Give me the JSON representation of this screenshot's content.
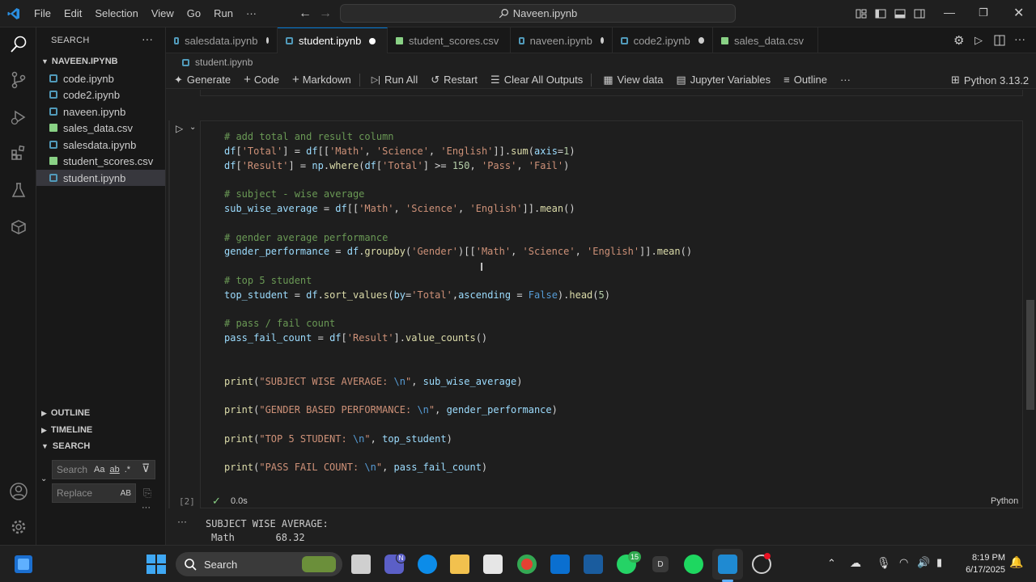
{
  "titlebar": {
    "menu": [
      "File",
      "Edit",
      "Selection",
      "View",
      "Go",
      "Run",
      "···"
    ],
    "search": "Naveen.ipynb"
  },
  "sidebar": {
    "title": "SEARCH",
    "folder": "NAVEEN.IPYNB",
    "files": [
      {
        "name": "code.ipynb",
        "type": "nb"
      },
      {
        "name": "code2.ipynb",
        "type": "nb"
      },
      {
        "name": "naveen.ipynb",
        "type": "nb"
      },
      {
        "name": "sales_data.csv",
        "type": "csv"
      },
      {
        "name": "salesdata.ipynb",
        "type": "nb"
      },
      {
        "name": "student_scores.csv",
        "type": "csv"
      },
      {
        "name": "student.ipynb",
        "type": "nb"
      }
    ],
    "sections": [
      "OUTLINE",
      "TIMELINE",
      "SEARCH"
    ],
    "search_placeholder": "Search",
    "replace_placeholder": "Replace",
    "search_opts": [
      "Aa",
      "ab",
      ".*"
    ],
    "replace_opt": "AB"
  },
  "tabs": [
    {
      "label": "salesdata.ipynb"
    },
    {
      "label": "student.ipynb"
    },
    {
      "label": "student_scores.csv"
    },
    {
      "label": "naveen.ipynb"
    },
    {
      "label": "code2.ipynb"
    },
    {
      "label": "sales_data.csv"
    }
  ],
  "breadcrumb": "student.ipynb",
  "toolbar": {
    "generate": "Generate",
    "code": "Code",
    "markdown": "Markdown",
    "run_all": "Run All",
    "restart": "Restart",
    "clear": "Clear All Outputs",
    "view_data": "View data",
    "jupyter_vars": "Jupyter Variables",
    "outline": "Outline",
    "more": "···",
    "kernel": "Python 3.13.2"
  },
  "cell": {
    "exec_count": "[2]",
    "status": "0.0s",
    "language": "Python",
    "output_line1": "SUBJECT WISE AVERAGE:",
    "output_line2": "Math       68.32",
    "output_more": "···"
  },
  "taskbar": {
    "search": "Search",
    "time": "8:19 PM",
    "date": "6/17/2025",
    "badge_teams": "N",
    "badge_whatsapp": "15",
    "app_d": "D"
  }
}
